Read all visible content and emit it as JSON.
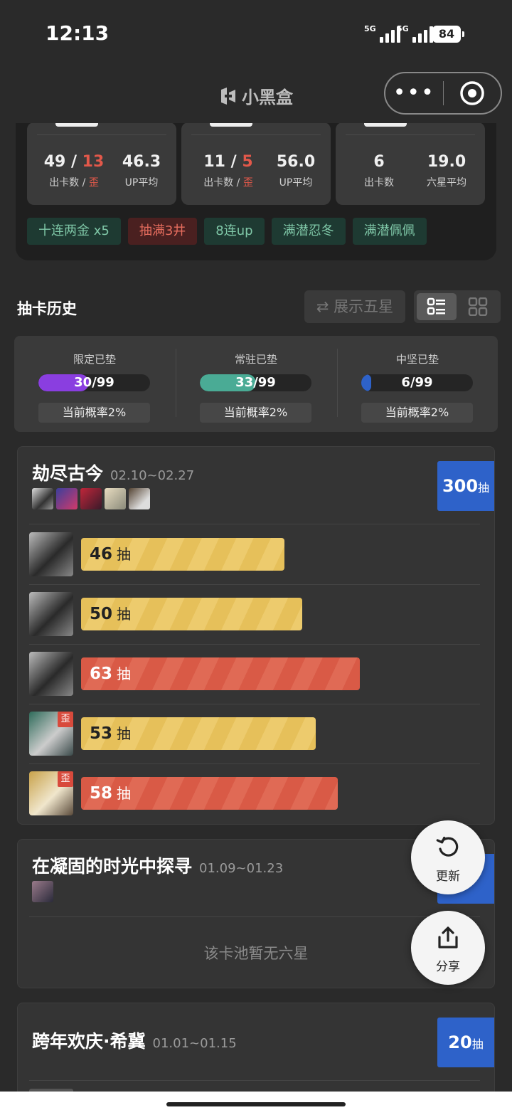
{
  "status": {
    "time": "12:13",
    "network1": "5G",
    "network2": "5G",
    "battery": "84"
  },
  "app": {
    "title": "小黑盒"
  },
  "summary": {
    "cards": [
      {
        "left_value": "49",
        "left_value_red": "13",
        "left_label": "出卡数",
        "left_label_red": "歪",
        "right_value": "46.3",
        "right_label": "UP平均"
      },
      {
        "left_value": "11",
        "left_value_red": "5",
        "left_label": "出卡数",
        "left_label_red": "歪",
        "right_value": "56.0",
        "right_label": "UP平均"
      },
      {
        "left_value": "6",
        "left_label": "出卡数",
        "right_value": "19.0",
        "right_label": "六星平均"
      }
    ],
    "tags": [
      {
        "text": "十连两金  x5",
        "type": "good"
      },
      {
        "text": "抽满3井",
        "type": "bad"
      },
      {
        "text": "8连up",
        "type": "good"
      },
      {
        "text": "满潜忍冬",
        "type": "good"
      },
      {
        "text": "满潜佩佩",
        "type": "good"
      }
    ]
  },
  "history": {
    "title": "抽卡历史",
    "show_five_star": "展示五星"
  },
  "pity": [
    {
      "name": "限定已垫",
      "current": 30,
      "max": 99,
      "text": "30/99",
      "rate": "当前概率2%",
      "color": "#8a3ee0"
    },
    {
      "name": "常驻已垫",
      "current": 33,
      "max": 99,
      "text": "33/99",
      "rate": "当前概率2%",
      "color": "#4aab95"
    },
    {
      "name": "中坚已垫",
      "current": 6,
      "max": 99,
      "text": "6/99",
      "rate": "当前概率2%",
      "color": "#2e62c9"
    }
  ],
  "pools": [
    {
      "name": "劫尽古今",
      "date": "02.10~02.27",
      "total": "300",
      "total_unit": "抽",
      "pulls": [
        {
          "count": 46,
          "unit": "抽",
          "status": "up",
          "off_banner": false
        },
        {
          "count": 50,
          "unit": "抽",
          "status": "up",
          "off_banner": false
        },
        {
          "count": 63,
          "unit": "抽",
          "status": "late",
          "off_banner": false
        },
        {
          "count": 53,
          "unit": "抽",
          "status": "up",
          "off_banner": true,
          "off_label": "歪"
        },
        {
          "count": 58,
          "unit": "抽",
          "status": "late",
          "off_banner": true,
          "off_label": "歪"
        }
      ]
    },
    {
      "name": "在凝固的时光中探寻",
      "date": "01.09~01.23",
      "total": "",
      "empty_text": "该卡池暂无六星"
    },
    {
      "name": "跨年欢庆·希冀",
      "date": "01.01~01.15",
      "total": "20",
      "total_unit": "抽"
    }
  ],
  "fabs": {
    "refresh": "更新",
    "share": "分享"
  },
  "colors": {
    "yellow_bar": "#e6c05a",
    "red_bar": "#d95a46",
    "blue_total": "#2e62c9",
    "tag_green": "#7fc7a7",
    "tag_red": "#e66d5e"
  }
}
